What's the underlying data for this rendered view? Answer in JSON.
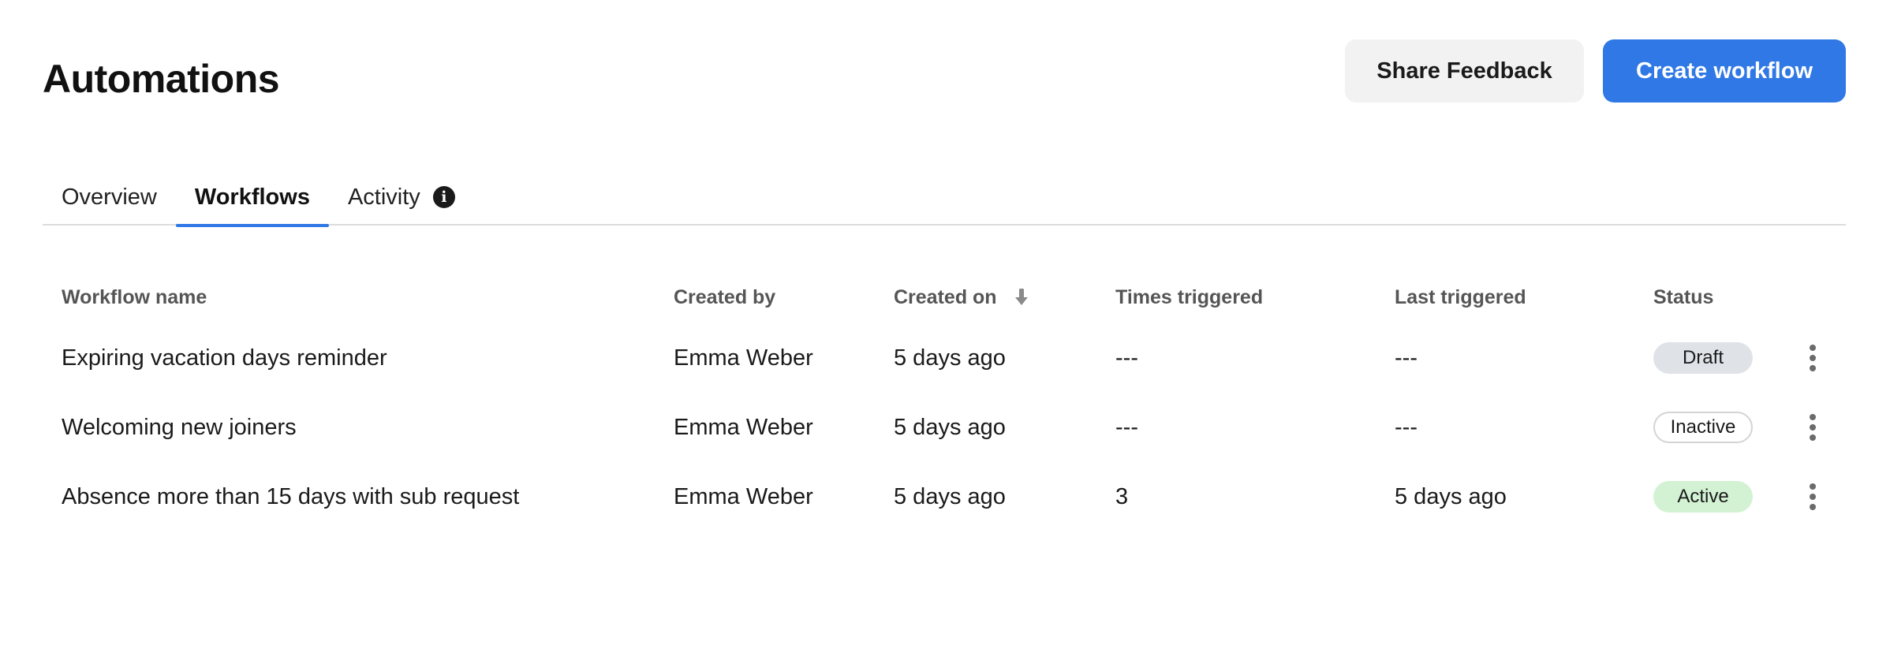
{
  "header": {
    "title": "Automations",
    "share_feedback_label": "Share Feedback",
    "create_workflow_label": "Create workflow"
  },
  "tabs": [
    {
      "label": "Overview",
      "active": false
    },
    {
      "label": "Workflows",
      "active": true
    },
    {
      "label": "Activity",
      "active": false,
      "icon": "info-icon"
    }
  ],
  "table": {
    "columns": {
      "name": "Workflow name",
      "created_by": "Created by",
      "created_on": "Created on",
      "times_triggered": "Times triggered",
      "last_triggered": "Last triggered",
      "status": "Status"
    },
    "sort": {
      "column": "created_on",
      "direction": "descending",
      "icon": "arrow-down-icon"
    },
    "rows": [
      {
        "name": "Expiring vacation days reminder",
        "created_by": "Emma Weber",
        "created_on": "5 days ago",
        "times_triggered": "---",
        "last_triggered": "---",
        "status": "Draft"
      },
      {
        "name": "Welcoming new joiners",
        "created_by": "Emma Weber",
        "created_on": "5 days ago",
        "times_triggered": "---",
        "last_triggered": "---",
        "status": "Inactive"
      },
      {
        "name": "Absence more than 15 days with sub request",
        "created_by": "Emma Weber",
        "created_on": "5 days ago",
        "times_triggered": "3",
        "last_triggered": "5 days ago",
        "status": "Active"
      }
    ]
  },
  "colors": {
    "accent": "#2f78e6",
    "draft_badge": "#dfe3e8",
    "active_badge": "#d3f2d3"
  }
}
